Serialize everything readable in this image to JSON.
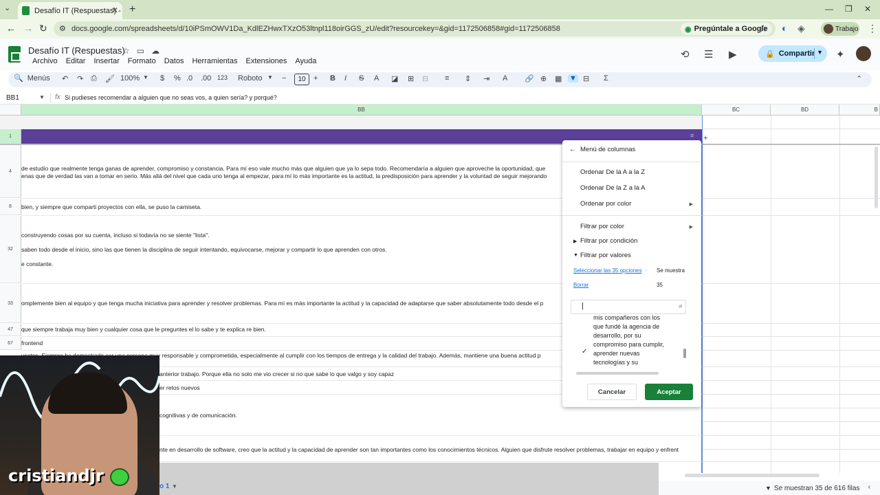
{
  "browser": {
    "tab_title": "Desafío IT (Respuestas) - Hojas",
    "url": "docs.google.com/spreadsheets/d/10iPSmOWV1Da_KdlEZHwxTXzO53ltnpl118oirGGS_zU/edit?resourcekey=&gid=1172506858#gid=1172506858",
    "gemini_label": "Pregúntale a Google",
    "profile_label": "Trabajo"
  },
  "sheets": {
    "doc_title": "Desafío IT (Respuestas)",
    "menu": [
      "Archivo",
      "Editar",
      "Insertar",
      "Formato",
      "Datos",
      "Herramientas",
      "Extensiones",
      "Ayuda"
    ],
    "share_label": "Compartir",
    "toolbar": {
      "search_menus": "Menús",
      "zoom": "100%",
      "currency": "$",
      "percent": "%",
      "dec_less": ".0",
      "dec_more": ".00",
      "number_format": "123",
      "font": "Roboto",
      "font_size": "10"
    },
    "name_box": "BB1",
    "formula": "Si pudieses recomendar a alguien que no seas vos, a quien sería? y porqué?"
  },
  "grid": {
    "columns": [
      "BB",
      "BC",
      "BD",
      "B"
    ],
    "rows": [
      {
        "num": "1",
        "text": ""
      },
      {
        "num": "4",
        "lines": [
          "de estudio que realmente tenga ganas de aprender, compromiso y constancia. Para mí eso vale mucho más que alguien que ya lo sepa todo. Recomendaría a alguien que aproveche la oportunidad, que",
          "enas que de verdad las van a tomar en serio. Más allá del nivel que cada uno tenga al empezar, para mí lo más importante es la actitud, la predisposición para aprender y la voluntad de seguir mejorando"
        ]
      },
      {
        "num": "8",
        "lines": [
          "bien, y siempre que comparti proyectos con ella, se puso la camiseta."
        ]
      },
      {
        "num": "32",
        "lines": [
          "construyendo cosas por su cuenta, incluso si todavía no se siente \"lista\".",
          "saben todo desde el inicio, sino las que tienen la disciplina de seguir intentando, equivocarse, mejorar y compartir lo que aprenden con otros.",
          "e constante."
        ]
      },
      {
        "num": "33",
        "lines": [
          "omplemente bien al equipo y que tenga mucha iniciativa para aprender y resolver problemas. Para mí es más importante la actitud y la capacidad de adaptarse que saber absolutamente todo desde el p"
        ]
      },
      {
        "num": "47",
        "lines": [
          "que siempre trabaja muy bien y cualquier cosa que le preguntes el lo sabe y te explica re bien."
        ]
      },
      {
        "num": "67",
        "lines": [
          "frontend"
        ]
      },
      {
        "num": "",
        "lines": [
          "yectos. Siempre ha demostrado ser una persona muy responsable y comprometida, especialmente al cumplir con los tiempos de entrega y la calidad del trabajo. Además, mantiene una buena actitud p"
        ]
      },
      {
        "num": "",
        "lines": [
          "anterior trabajo. Porque ella no solo me vio crecer si no que sabe lo que valgo y soy capaz"
        ]
      },
      {
        "num": "",
        "lines": [
          "er retos nuevos"
        ]
      },
      {
        "num": "",
        "lines": [
          "cognitivas y de comunicación."
        ]
      },
      {
        "num": "",
        "lines": [
          "nte en desarrollo de software, creo que la actitud y la capacidad de aprender son tan importantes como los conocimientos técnicos. Alguien que disfrute resolver problemas, trabajar en equipo y enfrent"
        ]
      }
    ]
  },
  "filter_menu": {
    "header": "Menú de columnas",
    "sort_az": "Ordenar De la A a la Z",
    "sort_za": "Ordenar De la Z a la A",
    "sort_color": "Ordenar por color",
    "filter_color": "Filtrar por color",
    "filter_condition": "Filtrar por condición",
    "filter_values": "Filtrar por valores",
    "select_all": "Seleccionar las 35 opciones",
    "select_all_sep": "·",
    "shown_label": "Se muestra",
    "clear": "Borrar",
    "shown_count": "35",
    "value_lines": [
      "mis compañeros con los",
      "que fundé la agencia de",
      "desarrollo, por su",
      "compromiso para cumplir,",
      "aprender nuevas",
      "tecnologías y su"
    ],
    "cancel": "Cancelar",
    "accept": "Aceptar"
  },
  "overlay": {
    "streamer_name": "cristiandjr :",
    "sheet_tab_partial": "o 1"
  },
  "status": {
    "rows_shown": "Se muestran 35 de 616 filas"
  },
  "colors": {
    "header_purple": "#5b3f99",
    "col_header_green": "#c6efce",
    "accept_green": "#188038",
    "share_blue": "#c2e7ff"
  }
}
